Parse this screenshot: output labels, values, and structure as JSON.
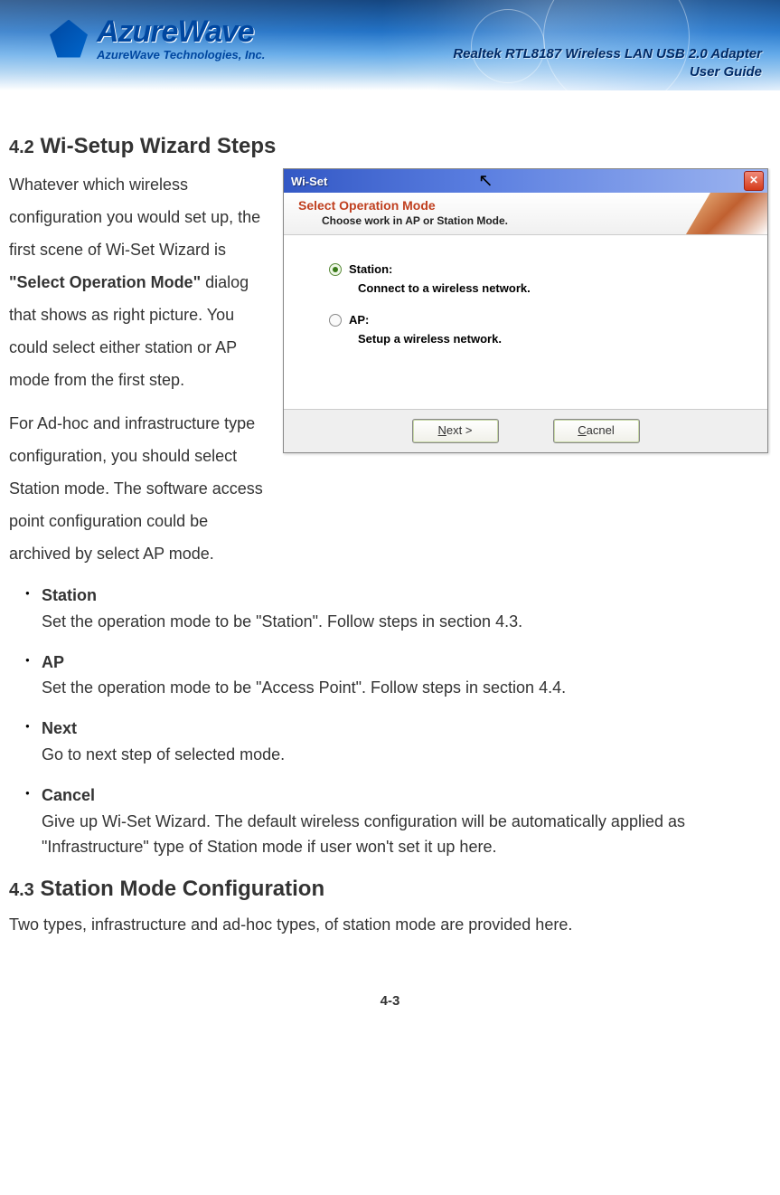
{
  "header": {
    "logo_main": "AzureWave",
    "logo_sub": "AzureWave  Technologies,  Inc.",
    "title_line1": "Realtek RTL8187 Wireless LAN USB 2.0 Adapter",
    "title_line2": "User Guide"
  },
  "section42": {
    "num": "4.2",
    "title": "Wi-Setup Wizard Steps",
    "para1a": "Whatever which wireless configuration you would set up, the first scene of Wi-Set Wizard is ",
    "para1b": "\"Select Operation Mode\"",
    "para1c": " dialog that shows as right picture. You could select either station or AP mode from the first step.",
    "para2": "For Ad-hoc and infrastructure type configuration, you should select Station mode. The software access point configuration could be archived by select AP mode."
  },
  "dialog": {
    "window_title": "Wi-Set",
    "header_title": "Select Operation Mode",
    "header_sub": "Choose work in AP or Station Mode.",
    "opt1_label": "Station:",
    "opt1_desc": "Connect to a wireless network.",
    "opt2_label": "AP:",
    "opt2_desc": "Setup a wireless network.",
    "btn_next_u": "N",
    "btn_next_rest": "ext >",
    "btn_cancel_u": "C",
    "btn_cancel_rest": "acnel"
  },
  "bullets": {
    "station_t": "Station",
    "station_d": "Set the operation mode to be \"Station\". Follow steps in section 4.3.",
    "ap_t": "AP",
    "ap_d": "Set the operation mode to be \"Access Point\". Follow steps in section 4.4.",
    "next_t": "Next",
    "next_d": "Go to next step of selected mode.",
    "cancel_t": "Cancel",
    "cancel_d": "Give up Wi-Set Wizard. The default wireless configuration will be automatically applied as \"Infrastructure\" type of Station mode if user won't set it up here."
  },
  "section43": {
    "num": "4.3",
    "title": "Station Mode Configuration",
    "para": "Two types, infrastructure and ad-hoc types, of station mode are provided here."
  },
  "page_num": "4-3"
}
